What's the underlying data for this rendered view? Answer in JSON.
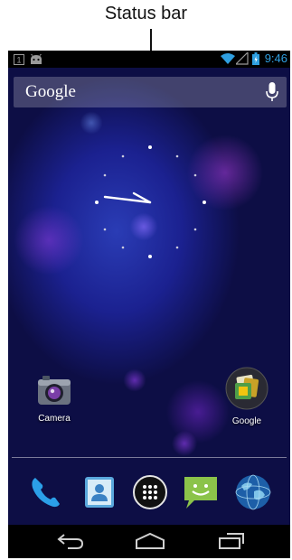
{
  "annotation": {
    "label": "Status bar"
  },
  "status_bar": {
    "time": "9:46",
    "time_color": "#2f9fe0",
    "icons": [
      "notification-1-icon",
      "android-debug-icon",
      "wifi-icon",
      "cellular-signal-icon",
      "battery-icon"
    ]
  },
  "search": {
    "label": "Google"
  },
  "home_apps": [
    {
      "label": "Camera"
    },
    {
      "label": "Google"
    }
  ],
  "dock": {
    "items": [
      "phone-icon",
      "people-icon",
      "all-apps-icon",
      "messaging-icon",
      "browser-icon"
    ]
  },
  "nav": {
    "buttons": [
      "back-icon",
      "home-icon",
      "recent-apps-icon"
    ]
  }
}
